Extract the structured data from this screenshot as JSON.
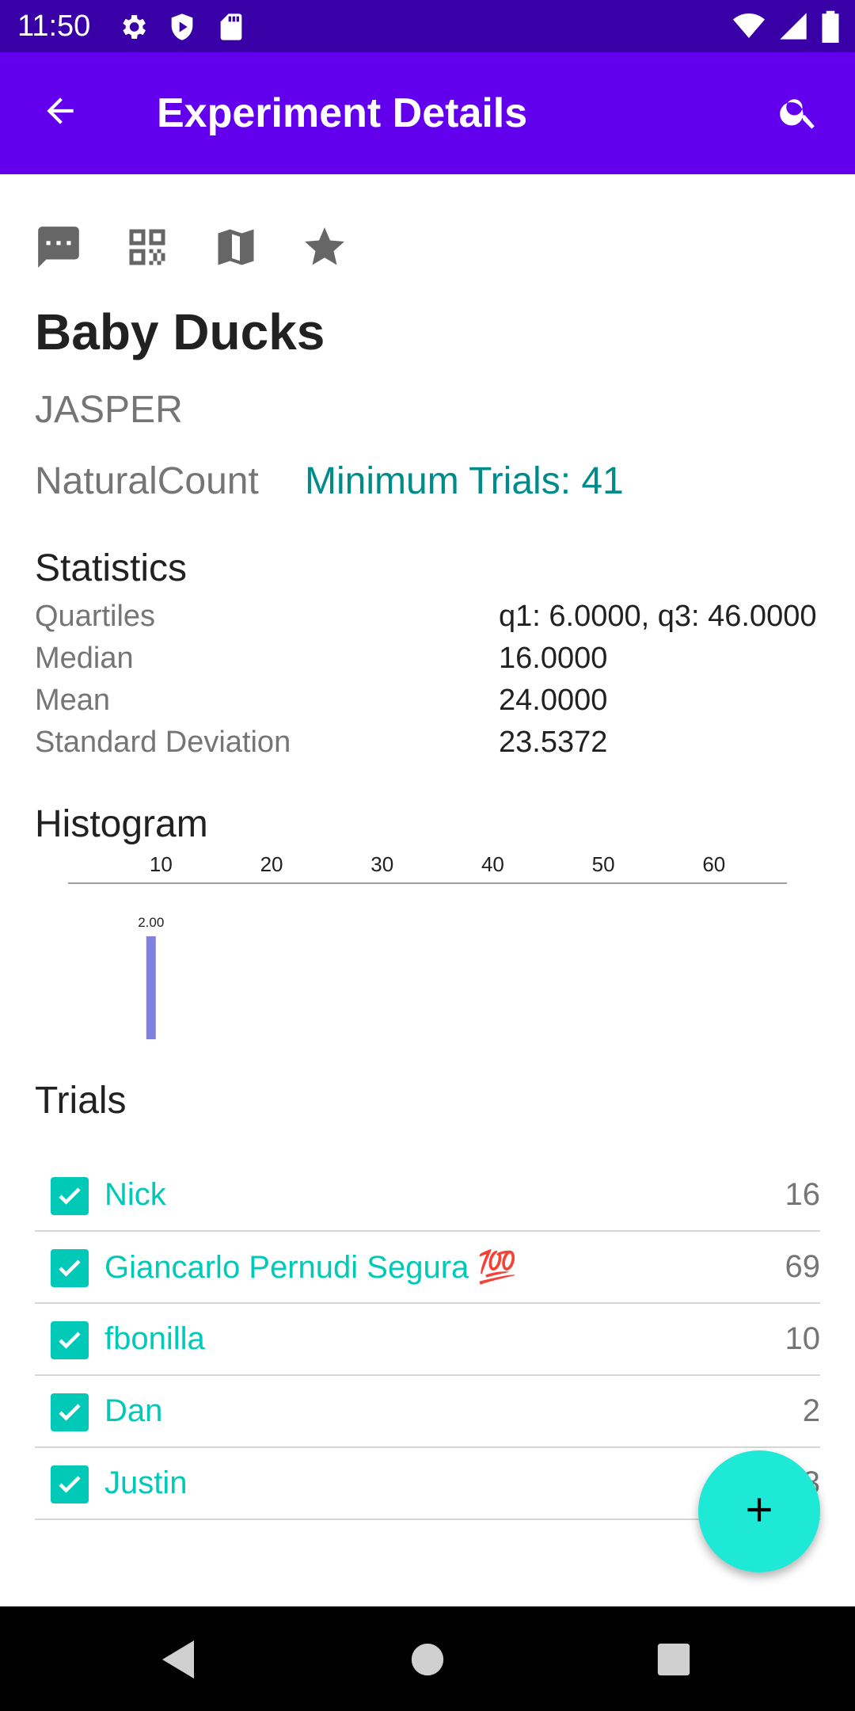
{
  "status_bar": {
    "time": "11:50",
    "left_icons": [
      "gear-icon",
      "shield-icon",
      "sd-card-icon"
    ],
    "right_icons": [
      "wifi-icon",
      "signal-icon",
      "battery-icon"
    ]
  },
  "app_bar": {
    "title": "Experiment Details",
    "back_icon": "arrow-back-icon",
    "search_icon": "search-icon",
    "color": "#6200ee"
  },
  "actions": [
    "comment-icon",
    "qr-code-icon",
    "map-icon",
    "star-icon"
  ],
  "experiment": {
    "title": "Baby Ducks",
    "owner": "JASPER",
    "type": "NaturalCount",
    "min_trials": "Minimum Trials: 41"
  },
  "statistics": {
    "heading": "Statistics",
    "rows": [
      {
        "label": "Quartiles",
        "value": "q1: 6.0000, q3: 46.0000"
      },
      {
        "label": "Median",
        "value": "16.0000"
      },
      {
        "label": "Mean",
        "value": "24.0000"
      },
      {
        "label": "Standard Deviation",
        "value": "23.5372"
      }
    ]
  },
  "histogram": {
    "heading": "Histogram"
  },
  "chart_data": {
    "type": "bar",
    "x_ticks": [
      10,
      20,
      30,
      40,
      50,
      60
    ],
    "xlim": [
      1.6,
      66.6
    ],
    "bars": [
      {
        "x": 9.1,
        "value": 2.0,
        "label": "2.00"
      }
    ],
    "ylim": [
      0,
      2.0
    ],
    "bar_color": "#8080e0",
    "title": "",
    "xlabel": "",
    "ylabel": ""
  },
  "trials": {
    "heading": "Trials",
    "items": [
      {
        "name": "Nick",
        "value": "16"
      },
      {
        "name": "Giancarlo Pernudi Segura 💯",
        "value": "69"
      },
      {
        "name": "fbonilla",
        "value": "10"
      },
      {
        "name": "Dan",
        "value": "2"
      },
      {
        "name": "Justin",
        "value": "3"
      }
    ],
    "accent": "#00c9b7"
  },
  "fab": {
    "icon": "plus-icon",
    "color": "#1de9d6"
  },
  "nav_bar": {
    "icons": [
      "back-triangle-icon",
      "home-circle-icon",
      "recents-square-icon"
    ]
  }
}
